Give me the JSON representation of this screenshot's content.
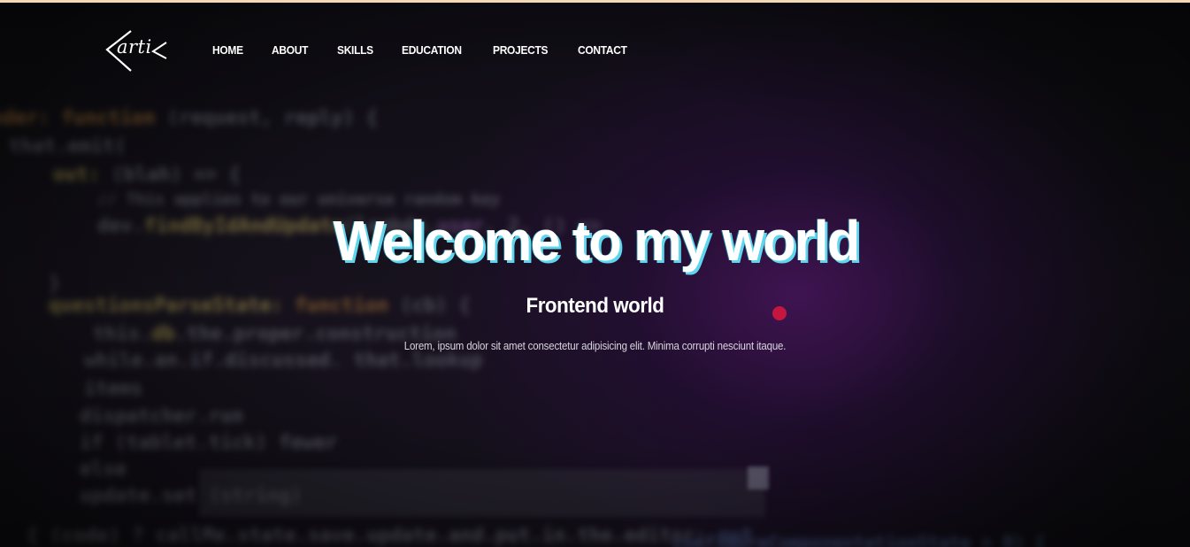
{
  "header": {
    "logo_text": "arti",
    "nav": [
      {
        "label": "HOME"
      },
      {
        "label": "ABOUT"
      },
      {
        "label": "SKILLS"
      },
      {
        "label": "EDUCATION"
      },
      {
        "label": "PROJECTS"
      },
      {
        "label": "CONTACT"
      }
    ]
  },
  "hero": {
    "title": "Welcome to my world",
    "subtitle": "Frontend world",
    "text": "Lorem, ipsum dolor sit amet consectetur adipisicing elit. Minima corrupti nesciunt itaque."
  },
  "colors": {
    "accent_cursor": "#c4173f",
    "title_shadow": "#5fd6ee",
    "top_border": "#f6d9b4"
  }
}
